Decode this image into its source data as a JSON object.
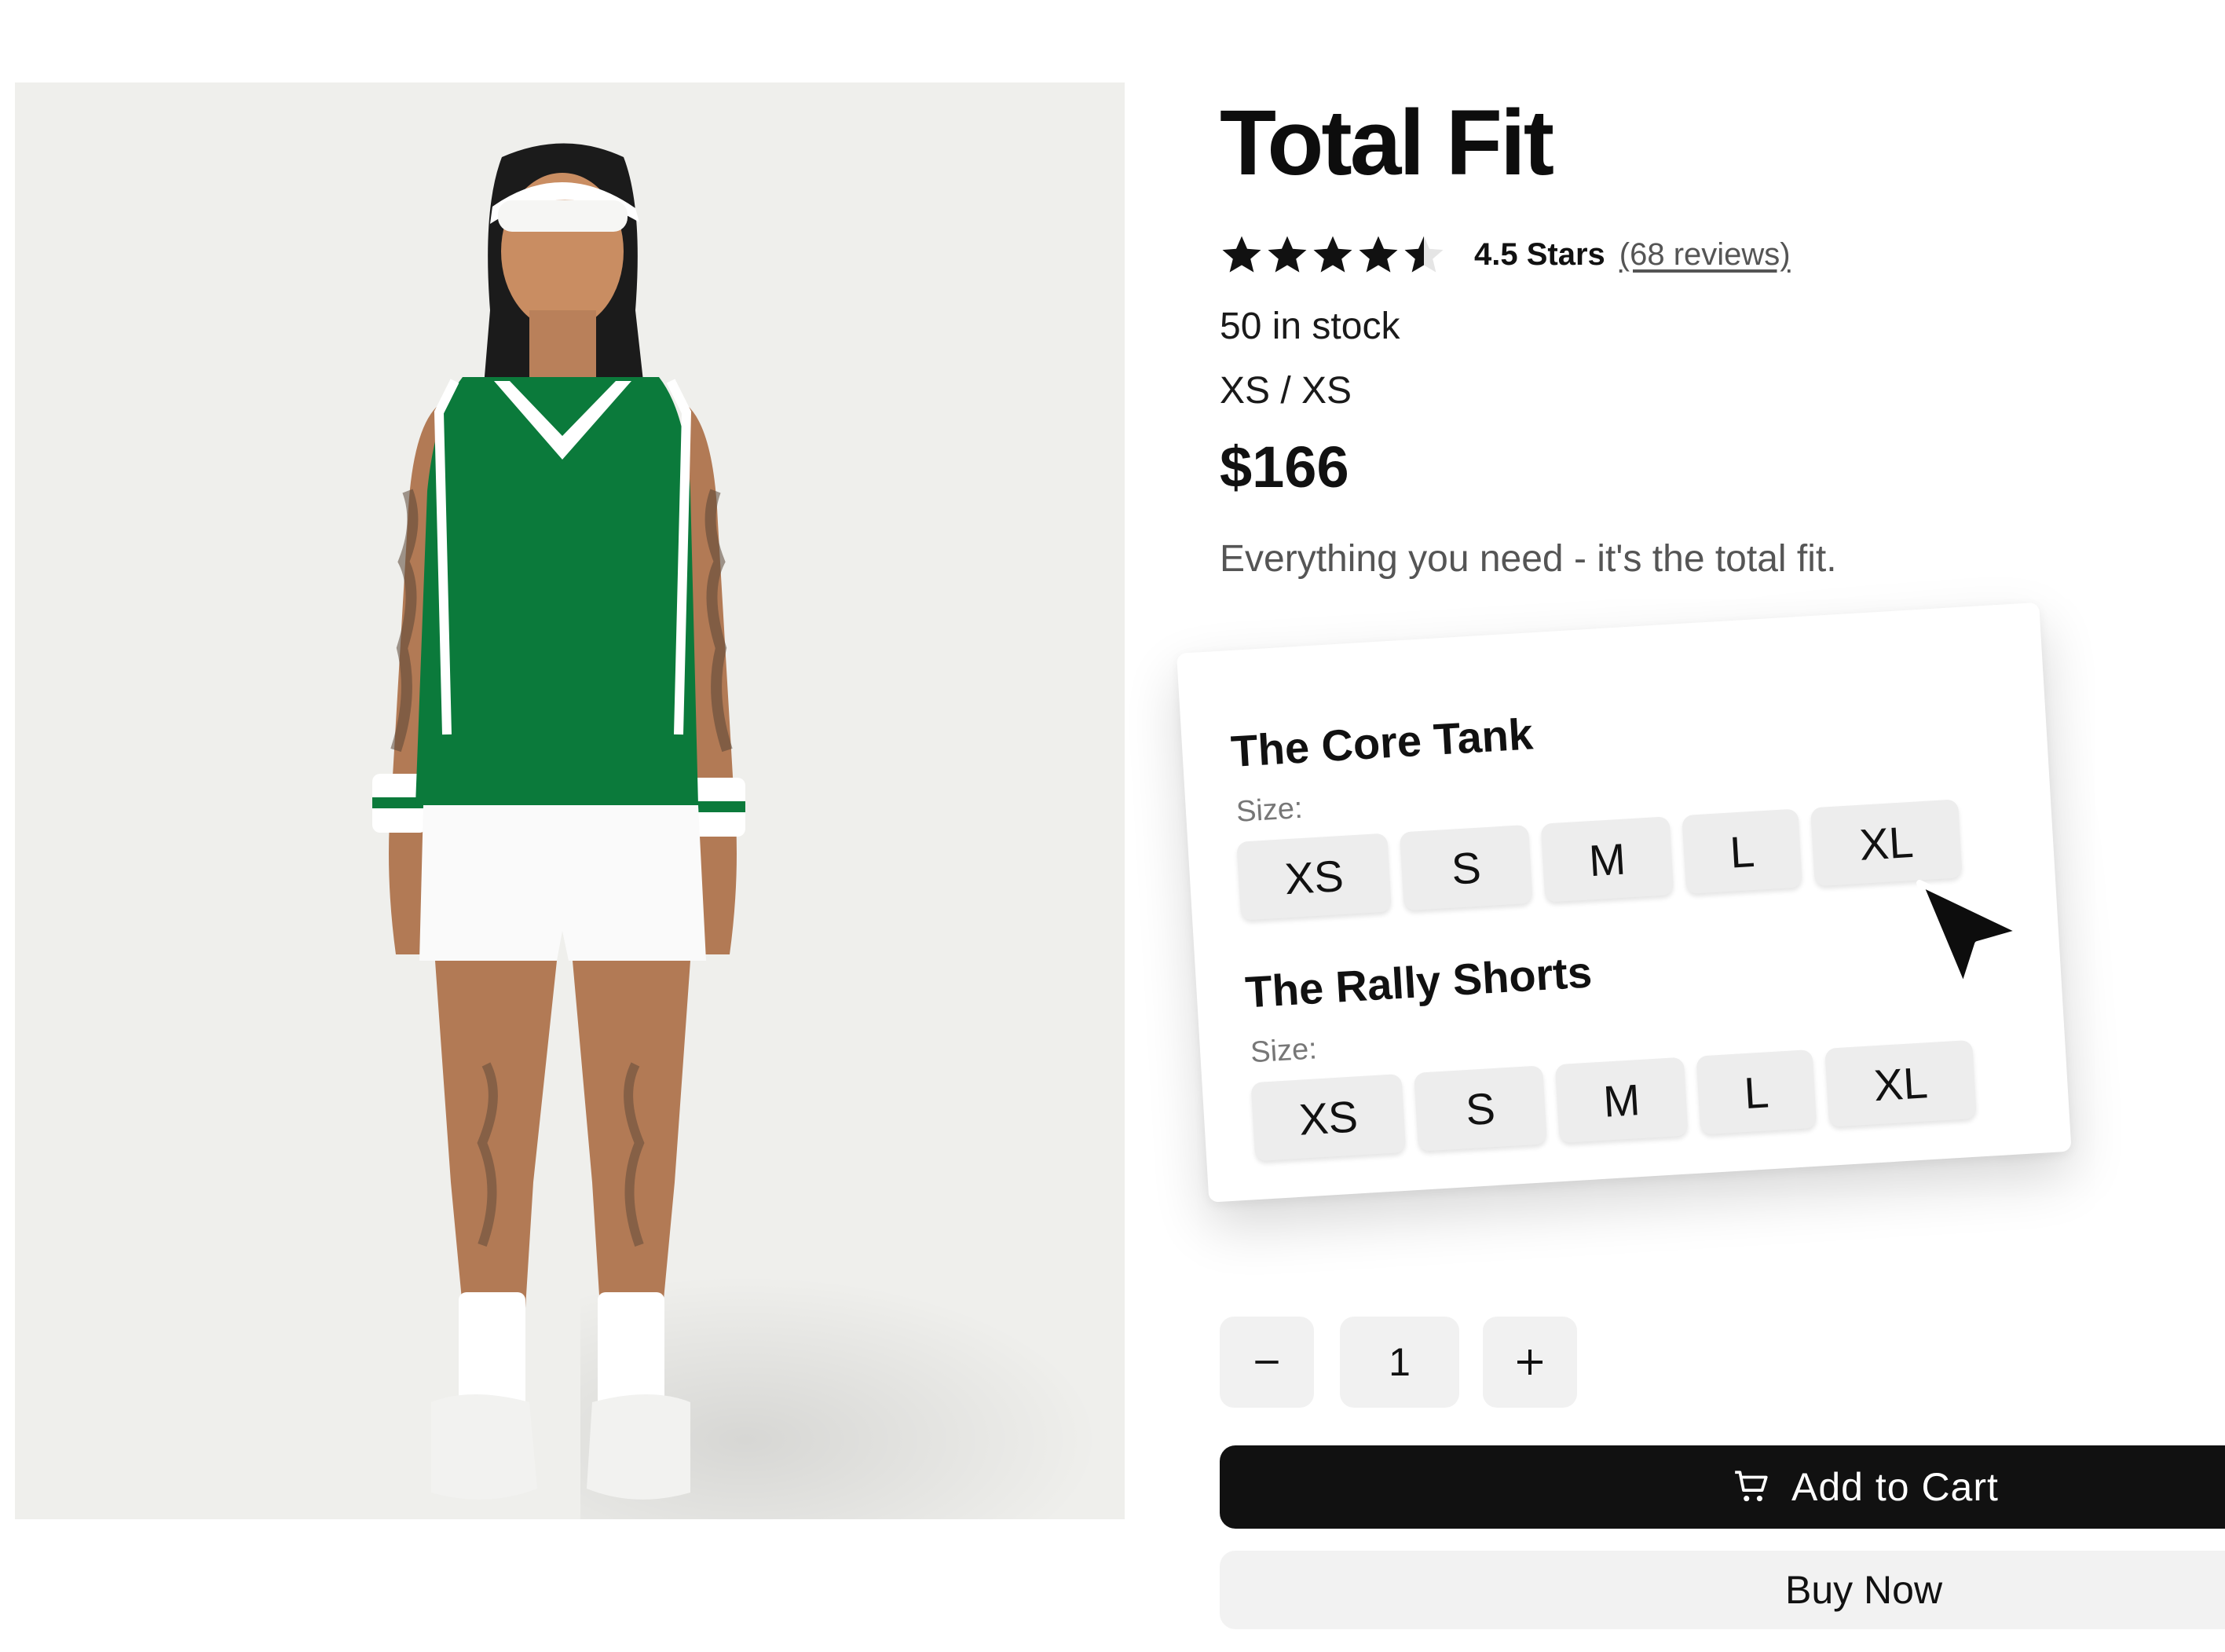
{
  "product": {
    "title": "Total Fit",
    "rating": 4.5,
    "rating_text": "4.5 Stars",
    "reviews_link": "(68 reviews)",
    "stock": "50 in stock",
    "variant": "XS / XS",
    "price": "$166",
    "description": "Everything you need - it's the total fit."
  },
  "options_card": {
    "items": [
      {
        "name": "The Core Tank",
        "size_label": "Size:",
        "sizes": [
          "XS",
          "S",
          "M",
          "L",
          "XL"
        ]
      },
      {
        "name": "The Rally Shorts",
        "size_label": "Size:",
        "sizes": [
          "XS",
          "S",
          "M",
          "L",
          "XL"
        ]
      }
    ]
  },
  "quantity": {
    "value": "1",
    "minus_icon": "minus-icon",
    "plus_icon": "plus-icon"
  },
  "actions": {
    "add_to_cart": "Add to Cart",
    "add_to_cart_icon": "cart-icon",
    "buy_now": "Buy Now"
  },
  "colors": {
    "jersey_green": "#0b7a3b",
    "photo_bg": "#efefec",
    "primary_button": "#111111",
    "secondary_button": "#f2f2f2",
    "size_button": "#ededed"
  }
}
